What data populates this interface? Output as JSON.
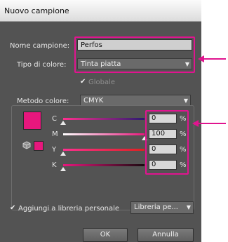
{
  "dialog": {
    "title": "Nuovo campione"
  },
  "swatch_name": {
    "label": "Nome campione:",
    "value": "Perfos"
  },
  "color_type": {
    "label": "Tipo di colore:",
    "value": "Tinta piatta"
  },
  "global": {
    "label": "Globale",
    "checked": true,
    "enabled": false
  },
  "color_mode": {
    "label": "Metodo colore:",
    "value": "CMYK"
  },
  "channels": [
    {
      "label": "C",
      "value": "0",
      "unit": "%"
    },
    {
      "label": "M",
      "value": "100",
      "unit": "%"
    },
    {
      "label": "Y",
      "value": "0",
      "unit": "%"
    },
    {
      "label": "K",
      "value": "0",
      "unit": "%"
    }
  ],
  "add_to_library": {
    "label": "Aggiungi a libreria personale",
    "checked": true,
    "library_value": "Libreria pe..."
  },
  "buttons": {
    "ok": "OK",
    "cancel": "Annulla"
  },
  "colors": {
    "highlight": "#e0148f",
    "swatch": "#e8177d",
    "dialog_bg": "#535353",
    "check_green": "#6ac04a"
  }
}
